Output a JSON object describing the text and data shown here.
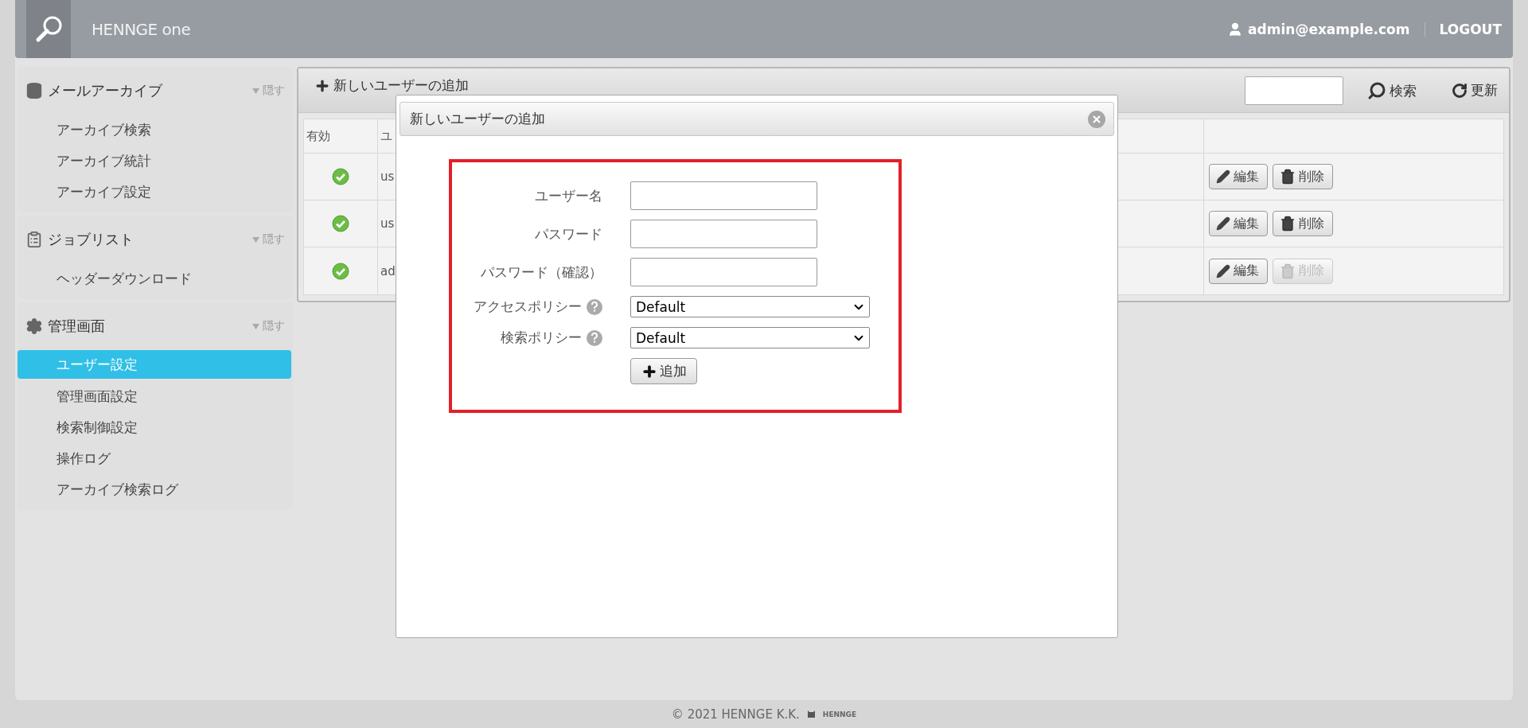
{
  "header": {
    "brand": "HENNGE one",
    "user": "admin@example.com",
    "logout": "LOGOUT"
  },
  "sidebar": [
    {
      "title": "メールアーカイブ",
      "hide": "隠す",
      "items": [
        {
          "label": "アーカイブ検索",
          "selected": false
        },
        {
          "label": "アーカイブ統計",
          "selected": false
        },
        {
          "label": "アーカイブ設定",
          "selected": false
        }
      ]
    },
    {
      "title": "ジョブリスト",
      "hide": "隠す",
      "items": [
        {
          "label": "ヘッダーダウンロード",
          "selected": false
        }
      ]
    },
    {
      "title": "管理画面",
      "hide": "隠す",
      "items": [
        {
          "label": "ユーザー設定",
          "selected": true
        },
        {
          "label": "管理画面設定",
          "selected": false
        },
        {
          "label": "検索制御設定",
          "selected": false
        },
        {
          "label": "操作ログ",
          "selected": false
        },
        {
          "label": "アーカイブ検索ログ",
          "selected": false
        }
      ]
    }
  ],
  "toolbar": {
    "add": "新しいユーザーの追加",
    "search": "検索",
    "refresh": "更新"
  },
  "table": {
    "columns": [
      "有効",
      "ユ"
    ],
    "rows": [
      {
        "enabled": true,
        "cell": "us",
        "edit": "編集",
        "delete": "削除",
        "delete_disabled": false
      },
      {
        "enabled": true,
        "cell": "us",
        "edit": "編集",
        "delete": "削除",
        "delete_disabled": false
      },
      {
        "enabled": true,
        "cell": "ad",
        "edit": "編集",
        "delete": "削除",
        "delete_disabled": true
      }
    ]
  },
  "dialog": {
    "title": "新しいユーザーの追加",
    "fields": [
      {
        "kind": "text",
        "label": "ユーザー名",
        "help": false
      },
      {
        "kind": "text",
        "label": "パスワード",
        "help": false
      },
      {
        "kind": "text",
        "label": "パスワード（確認）",
        "help": false
      },
      {
        "kind": "select",
        "label": "アクセスポリシー",
        "value": "Default",
        "help": true
      },
      {
        "kind": "select",
        "label": "検索ポリシー",
        "value": "Default",
        "help": true
      }
    ],
    "submit": "追加"
  },
  "footer": {
    "copyright": "© 2021 HENNGE K.K.",
    "logo": "HENNGE"
  }
}
